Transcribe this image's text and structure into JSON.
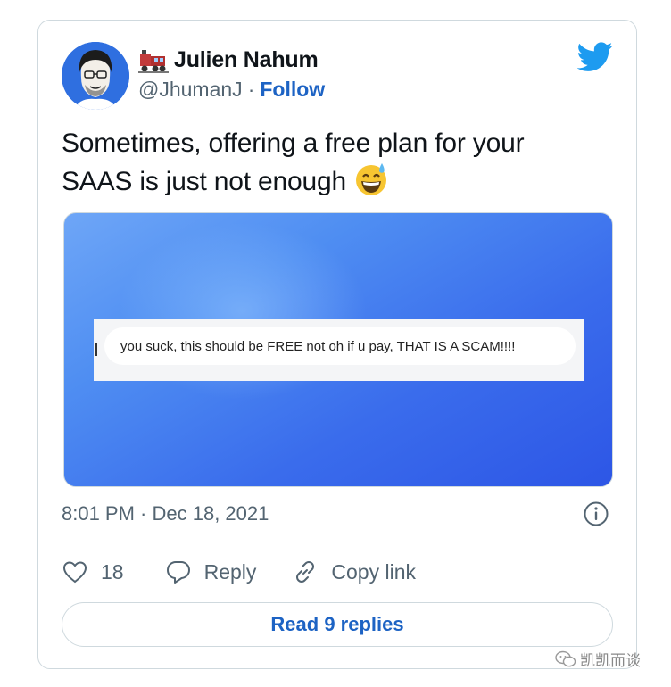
{
  "author": {
    "display_name": "Julien Nahum",
    "handle": "@JhumanJ",
    "follow_label": "Follow",
    "separator": "·",
    "name_emoji": "train-icon"
  },
  "tweet": {
    "text": "Sometimes, offering a free plan for your SAAS is just not enough",
    "emoji": "grinning-sweat-emoji"
  },
  "media": {
    "comment_text": "you suck, this should be FREE not oh if u pay, THAT IS A SCAM!!!!"
  },
  "meta": {
    "timestamp": "8:01 PM · Dec 18, 2021"
  },
  "actions": {
    "like_count": "18",
    "reply_label": "Reply",
    "copy_link_label": "Copy link"
  },
  "footer": {
    "read_replies_label": "Read 9 replies"
  },
  "watermark": {
    "text": "凯凯而谈"
  },
  "colors": {
    "accent": "#1d63c4",
    "twitter_blue": "#1d9bf0",
    "muted_text": "#536471",
    "border": "#cfd9de"
  }
}
